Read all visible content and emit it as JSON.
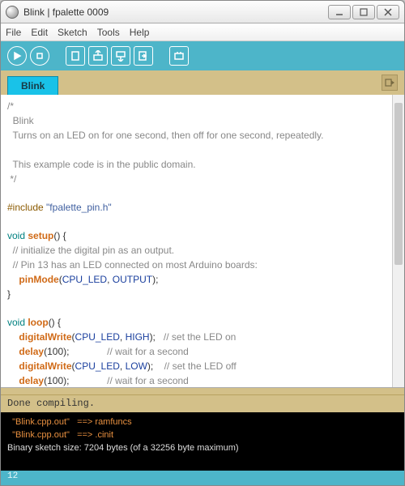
{
  "window": {
    "title": "Blink | fpalette 0009"
  },
  "menu": {
    "file": "File",
    "edit": "Edit",
    "sketch": "Sketch",
    "tools": "Tools",
    "help": "Help"
  },
  "tabs": {
    "active": "Blink"
  },
  "code": {
    "c1": "/*",
    "c2": "  Blink",
    "c3": "  Turns on an LED on for one second, then off for one second, repeatedly.",
    "c4": " ",
    "c5": "  This example code is in the public domain.",
    "c6": " */",
    "inc": "#include ",
    "incfile": "\"fpalette_pin.h\"",
    "void1": "void",
    "setup": " setup",
    "paren": "() {",
    "s1": "  // initialize the digital pin as an output.",
    "s2": "  // Pin 13 has an LED connected on most Arduino boards:",
    "pm": "pinMode",
    "pm_args_open": "(",
    "cpuled": "CPU_LED",
    "comma": ", ",
    "output": "OUTPUT",
    "close": ");",
    "rbrace": "}",
    "void2": "void",
    "loop": " loop",
    "dw": "digitalWrite",
    "high": "HIGH",
    "low": "LOW",
    "cmt_on": "   // set the LED on",
    "cmt_off": "    // set the LED off",
    "delay": "delay",
    "d100": "(100);",
    "cmt_wait": "              // wait for a second"
  },
  "status": {
    "msg": "Done compiling."
  },
  "console": {
    "l1a": "  \"Blink.cpp.out\"",
    "l1b": "   ==> ramfuncs",
    "l2a": "  \"Blink.cpp.out\"",
    "l2b": "   ==> .cinit",
    "l3": "Binary sketch size: 7204 bytes (of a 32256 byte maximum)"
  },
  "footer": {
    "line": "12"
  }
}
